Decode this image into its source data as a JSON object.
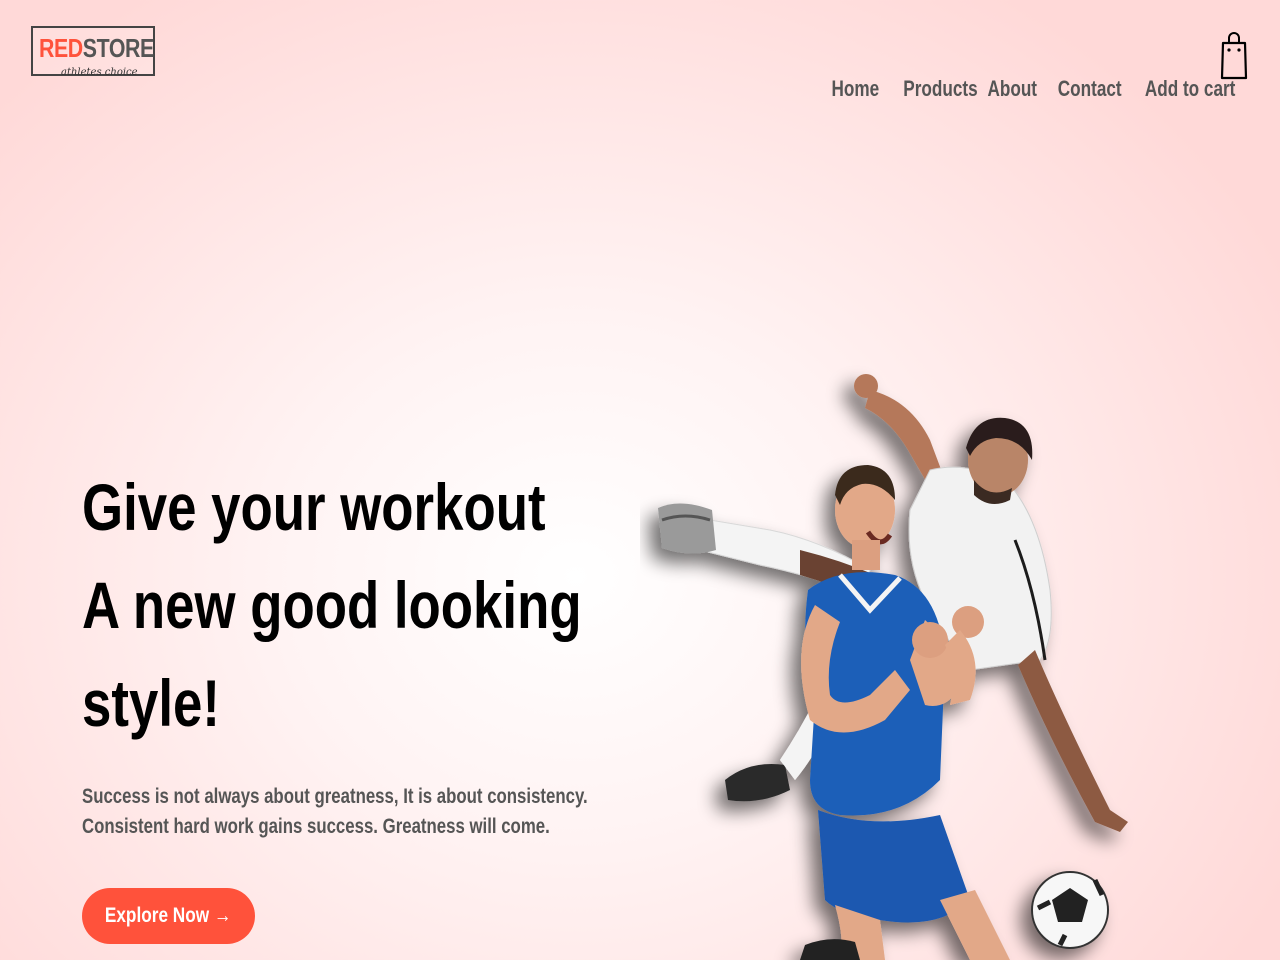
{
  "brand": {
    "name_red": "RED",
    "name_rest": "STORE",
    "tagline": "athletes choice"
  },
  "nav": {
    "items": [
      "Home",
      "Products",
      "About",
      "Contact",
      "Add to cart"
    ],
    "cart_icon": "shopping-bag-icon"
  },
  "hero": {
    "title_lines": [
      "Give your workout",
      "A new good looking",
      "style!"
    ],
    "subtitle": "Success is not always about greatness, It is about consistency. Consistent hard work gains success. Greatness will come.",
    "button_label": "Explore Now →"
  },
  "colors": {
    "accent": "#ff523b",
    "text_muted": "#555555",
    "background_edge": "#ffd9d8"
  }
}
